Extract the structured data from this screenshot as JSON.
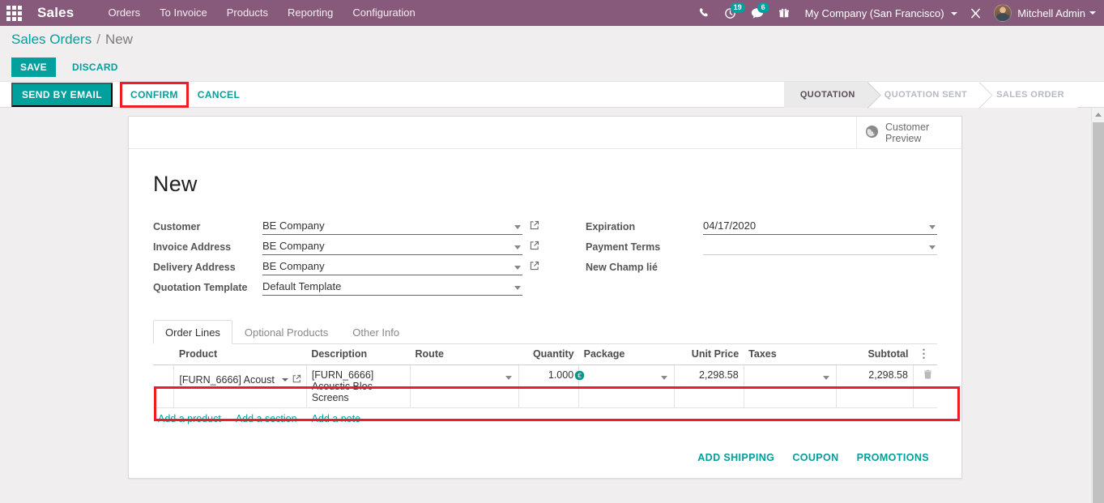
{
  "navbar": {
    "apps_icon": "apps-grid-icon",
    "brand": "Sales",
    "menu": [
      {
        "label": "Orders"
      },
      {
        "label": "To Invoice"
      },
      {
        "label": "Products"
      },
      {
        "label": "Reporting"
      },
      {
        "label": "Configuration"
      }
    ],
    "icons": [
      {
        "name": "phone-icon",
        "badge": ""
      },
      {
        "name": "activity-clock-icon",
        "badge": "19"
      },
      {
        "name": "messages-icon",
        "badge": "6"
      },
      {
        "name": "gift-icon",
        "badge": ""
      }
    ],
    "company": "My Company (San Francisco)",
    "debug_icon": "debug-wrench-icon",
    "user": "Mitchell Admin",
    "accent": "#875a7b",
    "badge_color": "#00a09d"
  },
  "breadcrumb": {
    "root": "Sales Orders",
    "separator": "/",
    "current": "New"
  },
  "edit_bar": {
    "save": "SAVE",
    "discard": "DISCARD"
  },
  "actions": {
    "send_by_email": "SEND BY EMAIL",
    "confirm": "CONFIRM",
    "cancel": "CANCEL",
    "highlight_color": "#ee1c25"
  },
  "statusbar": {
    "stages": [
      {
        "label": "QUOTATION",
        "active": true
      },
      {
        "label": "QUOTATION SENT",
        "active": false
      },
      {
        "label": "SALES ORDER",
        "active": false
      }
    ]
  },
  "stat_button": {
    "icon": "globe-icon",
    "line1": "Customer",
    "line2": "Preview"
  },
  "record": {
    "title": "New",
    "left_fields": [
      {
        "label": "Customer",
        "value": "BE Company",
        "dropdown": true,
        "external": true
      },
      {
        "label": "Invoice Address",
        "value": "BE Company",
        "dropdown": true,
        "external": true
      },
      {
        "label": "Delivery Address",
        "value": "BE Company",
        "dropdown": true,
        "external": true
      },
      {
        "label": "Quotation Template",
        "value": "Default Template",
        "dropdown": true,
        "external": false
      }
    ],
    "right_fields": [
      {
        "label": "Expiration",
        "value": "04/17/2020",
        "dropdown": true,
        "empty": false
      },
      {
        "label": "Payment Terms",
        "value": "",
        "dropdown": true,
        "empty": true
      },
      {
        "label": "New Champ lié",
        "value": "",
        "dropdown": false,
        "empty": true,
        "noline": true
      }
    ]
  },
  "notebook": {
    "tabs": [
      {
        "label": "Order Lines",
        "active": true
      },
      {
        "label": "Optional Products",
        "active": false
      },
      {
        "label": "Other Info",
        "active": false
      }
    ]
  },
  "order_lines": {
    "columns": [
      "Product",
      "Description",
      "Route",
      "Quantity",
      "Package",
      "Unit Price",
      "Taxes",
      "Subtotal"
    ],
    "options_icon": "column-options-icon",
    "rows": [
      {
        "product": "[FURN_6666] Acoust",
        "product_external_icon": "external-link-icon",
        "description": "[FURN_6666] Acoustic Bloc Screens",
        "route": "",
        "quantity": "1.000",
        "quantity_badge_icon": "currency-euro-icon",
        "package": "",
        "unit_price": "2,298.58",
        "taxes": "",
        "subtotal": "2,298.58",
        "delete_icon": "trash-icon",
        "highlighted": true
      }
    ],
    "add_links": [
      {
        "label": "Add a product"
      },
      {
        "label": "Add a section"
      },
      {
        "label": "Add a note"
      }
    ]
  },
  "bottom_actions": [
    {
      "label": "ADD SHIPPING"
    },
    {
      "label": "COUPON"
    },
    {
      "label": "PROMOTIONS"
    }
  ],
  "theme": {
    "primary": "#00a09d",
    "navbar": "#875a7b",
    "highlight": "#ee1c25"
  }
}
